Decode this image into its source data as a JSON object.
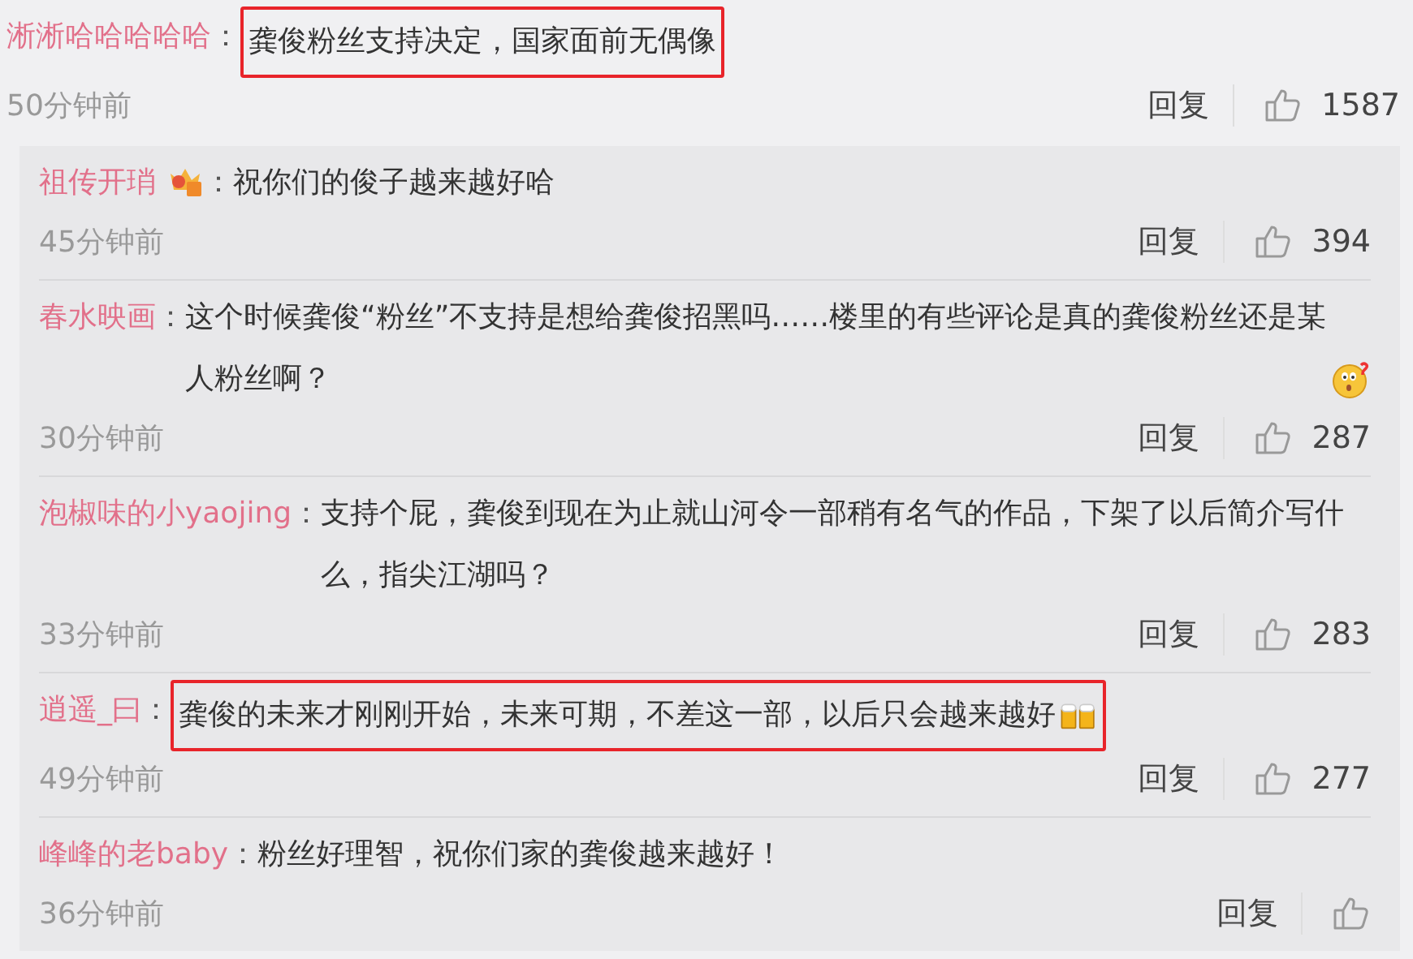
{
  "comment": {
    "user": "淅淅哈哈哈哈哈",
    "colon": "：",
    "text": "龚俊粉丝支持决定，国家面前无偶像",
    "highlighted": true,
    "time": "50分钟前",
    "reply_label": "回复",
    "likes": "1587"
  },
  "replies": [
    {
      "user": "祖传开琑",
      "badge": true,
      "colon": "：",
      "text": "祝你们的俊子越来越好哈",
      "highlighted": false,
      "time": "45分钟前",
      "reply_label": "回复",
      "likes": "394"
    },
    {
      "user": "春水映画",
      "badge": false,
      "colon": "：",
      "text": "这个时候龚俊“粉丝”不支持是想给龚俊招黑吗……楼里的有些评论是真的龚俊粉丝还是某人粉丝啊？",
      "emoji": {
        "kind": "surprised"
      },
      "highlighted": false,
      "time": "30分钟前",
      "reply_label": "回复",
      "likes": "287"
    },
    {
      "user": "泡椒味的小yaojing",
      "badge": false,
      "colon": "：",
      "text": "支持个屁，龚俊到现在为止就山河令一部稍有名气的作品，下架了以后简介写什么，指尖江湖吗？",
      "highlighted": false,
      "time": "33分钟前",
      "reply_label": "回复",
      "likes": "283"
    },
    {
      "user": "逍遥_曰",
      "badge": false,
      "colon": "：",
      "text": "龚俊的未来才刚刚开始，未来可期，不差这一部，以后只会越来越好",
      "emoji": {
        "kind": "beer"
      },
      "highlighted": true,
      "time": "49分钟前",
      "reply_label": "回复",
      "likes": "277"
    },
    {
      "user": "峰峰的老baby",
      "badge": false,
      "colon": "：",
      "text": "粉丝好理智，祝你们家的龚俊越来越好！",
      "highlighted": false,
      "time": "36分钟前",
      "reply_label": "回复"
    }
  ]
}
